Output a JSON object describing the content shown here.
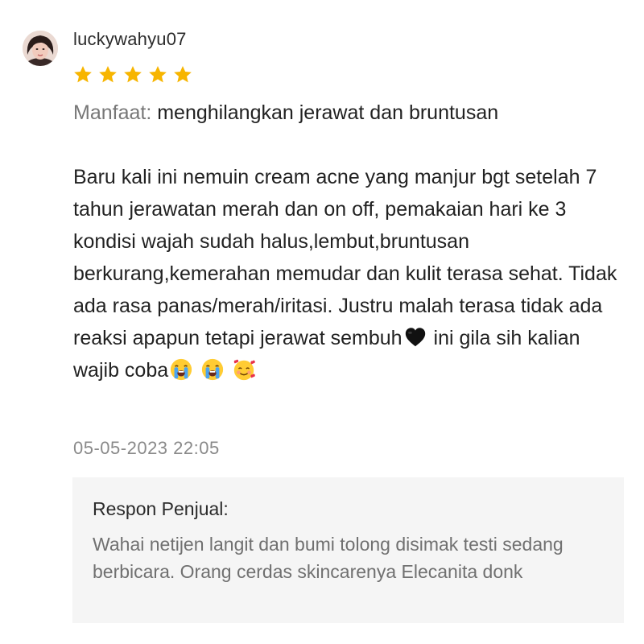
{
  "review": {
    "username": "luckywahyu07",
    "rating": 5,
    "star_color": "#f7b500",
    "benefit_label": "Manfaat:",
    "benefit_value": "menghilangkan jerawat dan bruntusan",
    "body_text": "Baru kali ini nemuin cream acne yang manjur bgt setelah 7 tahun jerawatan merah dan on off, pemakaian hari ke 3 kondisi wajah sudah halus,lembut,bruntusan berkurang,kemerahan memudar dan kulit terasa sehat. Tidak ada rasa panas/merah/iritasi. Justru malah terasa tidak ada reaksi apapun tetapi jerawat sembuh",
    "body_text_after_heart": "ini gila sih kalian wajib coba",
    "emojis": [
      "black-heart-icon",
      "loudly-crying-face-icon",
      "loudly-crying-face-icon",
      "smiling-face-with-hearts-icon"
    ],
    "timestamp": "05-05-2023 22:05"
  },
  "seller_response": {
    "title": "Respon Penjual:",
    "text": "Wahai netijen langit dan bumi tolong disimak testi sedang berbicara. Orang cerdas skincarenya Elecanita donk"
  }
}
